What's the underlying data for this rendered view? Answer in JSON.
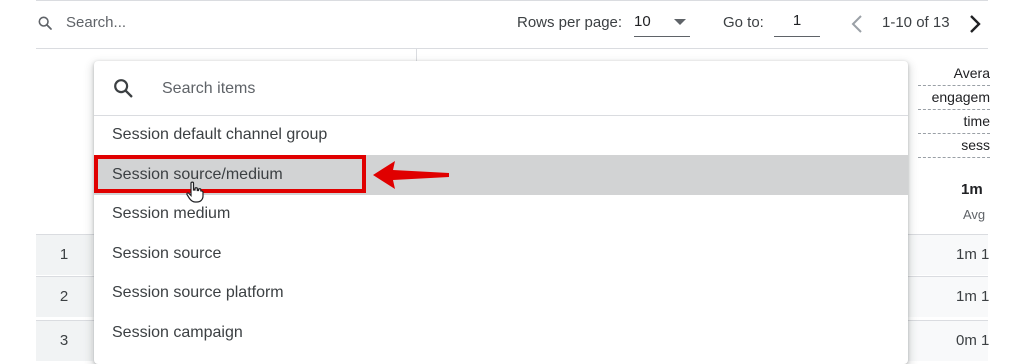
{
  "toolbar": {
    "search_placeholder": "Search...",
    "rows_per_page_label": "Rows per page:",
    "rows_per_page_value": "10",
    "goto_label": "Go to:",
    "goto_value": "1",
    "range_text": "1-10 of 13"
  },
  "metric_column": {
    "header_lines": [
      "Avera",
      "engagem",
      "time",
      "sess"
    ],
    "total": "1m",
    "total_sub": "Avg"
  },
  "rows": [
    {
      "num": "1",
      "value": "1m 1"
    },
    {
      "num": "2",
      "value": "1m 1"
    },
    {
      "num": "3",
      "value": "0m 1"
    }
  ],
  "dropdown": {
    "search_placeholder": "Search items",
    "items": [
      {
        "label": "Session default channel group"
      },
      {
        "label": "Session source/medium"
      },
      {
        "label": "Session medium"
      },
      {
        "label": "Session source"
      },
      {
        "label": "Session source platform"
      },
      {
        "label": "Session campaign"
      }
    ],
    "selected_index": 1
  },
  "colors": {
    "highlight": "#e00000",
    "hover": "#d2d3d4",
    "border": "#dadce0"
  }
}
